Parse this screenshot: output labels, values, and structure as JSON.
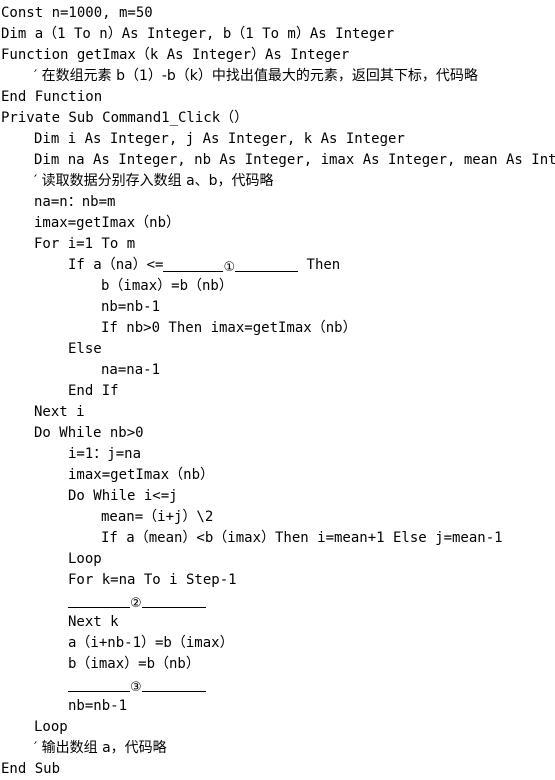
{
  "document": {
    "type": "code-listing",
    "language": "Visual Basic",
    "background_color": "#ffffff",
    "text_color": "#000000"
  },
  "code": {
    "lines": [
      {
        "indent": 0,
        "text": "Const n=1000, m=50"
      },
      {
        "indent": 0,
        "text": "Dim a（1 To n）As Integer, b（1 To m）As Integer"
      },
      {
        "indent": 0,
        "text": "Function getImax（k As Integer）As Integer"
      },
      {
        "indent": 1,
        "text": "′ 在数组元素 b（1）-b（k）中找出值最大的元素，返回其下标，代码略"
      },
      {
        "indent": 0,
        "text": "End Function"
      },
      {
        "indent": 0,
        "text": "Private Sub Command1_Click（）"
      },
      {
        "indent": 1,
        "text": "Dim i As Integer, j As Integer, k As Integer"
      },
      {
        "indent": 1,
        "text": "Dim na As Integer, nb As Integer, imax As Integer, mean As Integer"
      },
      {
        "indent": 1,
        "text": "′ 读取数据分别存入数组 a、b，代码略"
      },
      {
        "indent": 1,
        "text": "na=n：nb=m"
      },
      {
        "indent": 1,
        "text": "imax=getImax（nb）"
      },
      {
        "indent": 1,
        "text": "For i=1 To m"
      },
      {
        "indent": 2,
        "text": "If a（na）<=",
        "blank": "①",
        "text_after": " Then"
      },
      {
        "indent": 3,
        "text": "b（imax）=b（nb）"
      },
      {
        "indent": 3,
        "text": "nb=nb-1"
      },
      {
        "indent": 3,
        "text": "If nb>0 Then imax=getImax（nb）"
      },
      {
        "indent": 2,
        "text": "Else"
      },
      {
        "indent": 3,
        "text": "na=na-1"
      },
      {
        "indent": 2,
        "text": "End If"
      },
      {
        "indent": 1,
        "text": "Next i"
      },
      {
        "indent": 1,
        "text": "Do While nb>0"
      },
      {
        "indent": 2,
        "text": "i=1：j=na"
      },
      {
        "indent": 2,
        "text": "imax=getImax（nb）"
      },
      {
        "indent": 2,
        "text": "Do While i<=j"
      },
      {
        "indent": 3,
        "text": "mean=（i+j）\\2"
      },
      {
        "indent": 3,
        "text": "If a（mean）<b（imax）Then i=mean+1 Else j=mean-1"
      },
      {
        "indent": 2,
        "text": "Loop"
      },
      {
        "indent": 2,
        "text": "For k=na To i Step-1"
      },
      {
        "indent": 2,
        "text": "",
        "blank": "②",
        "text_after": ""
      },
      {
        "indent": 2,
        "text": "Next k"
      },
      {
        "indent": 2,
        "text": "a（i+nb-1）=b（imax）"
      },
      {
        "indent": 2,
        "text": "b（imax）=b（nb）"
      },
      {
        "indent": 2,
        "text": "",
        "blank": "③",
        "text_after": ""
      },
      {
        "indent": 2,
        "text": "nb=nb-1"
      },
      {
        "indent": 1,
        "text": "Loop"
      },
      {
        "indent": 1,
        "text": "′ 输出数组 a，代码略"
      },
      {
        "indent": 0,
        "text": "End Sub"
      }
    ]
  },
  "blanks": {
    "first": "①",
    "second": "②",
    "third": "③"
  },
  "lines": {
    "l01": "Const n=1000, m=50",
    "l02": "Dim a（1 To n）As Integer, b（1 To m）As Integer",
    "l03": "Function getImax（k As Integer）As Integer",
    "l04": "′ 在数组元素 b（1）-b（k）中找出值最大的元素，返回其下标，代码略",
    "l05": "End Function",
    "l06": "Private Sub Command1_Click（）",
    "l07": "Dim i As Integer, j As Integer, k As Integer",
    "l08": "Dim na As Integer, nb As Integer, imax As Integer, mean As Integer",
    "l09": "′ 读取数据分别存入数组 a、b，代码略",
    "l10": "na=n：nb=m",
    "l11": "imax=getImax（nb）",
    "l12": "For i=1 To m",
    "l13a": "If a（na）<=",
    "l13b": " Then",
    "l14": "b（imax）=b（nb）",
    "l15": "nb=nb-1",
    "l16": "If nb>0 Then imax=getImax（nb）",
    "l17": "Else",
    "l18": "na=na-1",
    "l19": "End If",
    "l20": "Next i",
    "l21": "Do While nb>0",
    "l22": "i=1：j=na",
    "l23": "imax=getImax（nb）",
    "l24": "Do While i<=j",
    "l25": "mean=（i+j）\\2",
    "l26": "If a（mean）<b（imax）Then i=mean+1 Else j=mean-1",
    "l27": "Loop",
    "l28": "For k=na To i Step-1",
    "l30": "Next k",
    "l31": "a（i+nb-1）=b（imax）",
    "l32": "b（imax）=b（nb）",
    "l34": "nb=nb-1",
    "l35": "Loop",
    "l36": "′ 输出数组 a，代码略",
    "l37": "End Sub"
  }
}
